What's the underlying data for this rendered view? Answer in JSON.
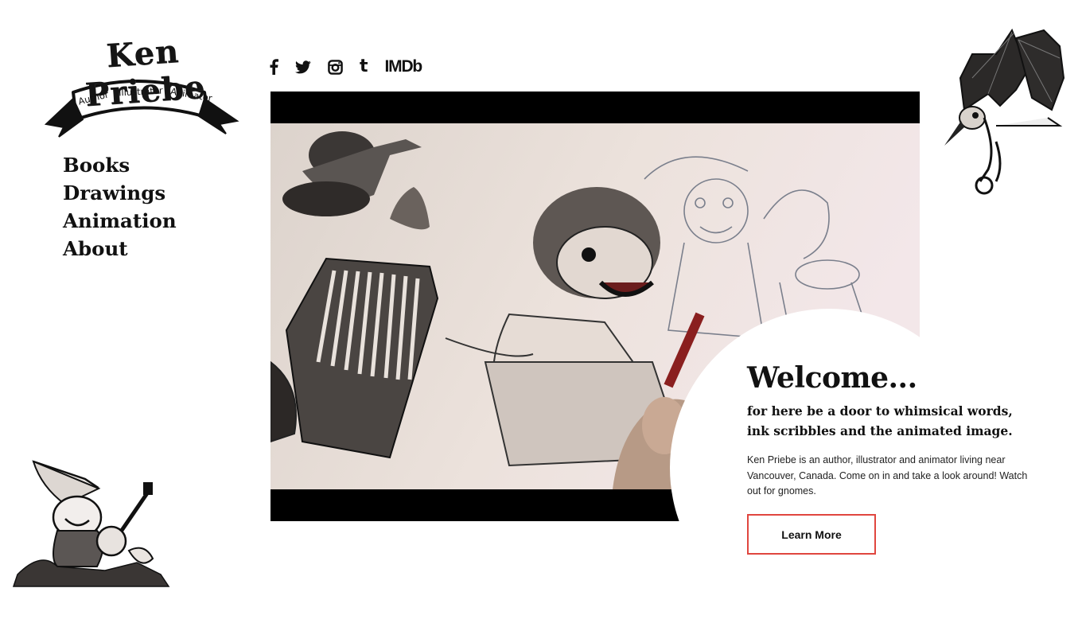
{
  "logo": {
    "title": "Ken Priebe",
    "ribbon": [
      "Author",
      "Illustrator",
      "Animator"
    ]
  },
  "nav": {
    "items": [
      {
        "label": "Books"
      },
      {
        "label": "Drawings"
      },
      {
        "label": "Animation"
      },
      {
        "label": "About"
      }
    ]
  },
  "social": {
    "icons": [
      "facebook-icon",
      "twitter-icon",
      "instagram-icon",
      "tumblr-icon"
    ],
    "imdb_label": "IMDb"
  },
  "welcome": {
    "heading": "Welcome...",
    "tagline": "for here be a door to whimsical words, ink scribbles and the animated image.",
    "bio": "Ken Priebe is an author, illustrator and animator living near Vancouver, Canada. Come on in and take a look around! Watch out for gnomes.",
    "cta_label": "Learn More"
  },
  "colors": {
    "accent_border": "#e0463f",
    "text": "#111111",
    "video_letterbox": "#000000",
    "paper": "#e8ddd6"
  }
}
